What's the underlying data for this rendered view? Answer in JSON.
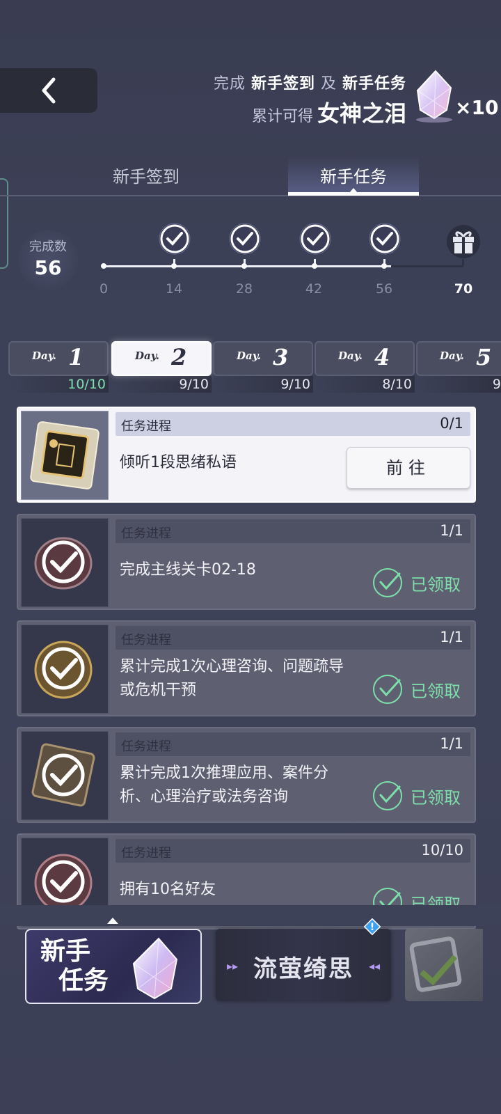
{
  "header": {
    "promo_prefix": "完成",
    "promo_item1": "新手签到",
    "promo_and": "及",
    "promo_item2": "新手任务",
    "promo_line2_prefix": "累计可得",
    "reward_name": "女神之泪",
    "reward_count": "×10"
  },
  "tabs": [
    {
      "label": "新手签到",
      "active": false
    },
    {
      "label": "新手任务",
      "active": true
    }
  ],
  "completion": {
    "label": "完成数",
    "value": "56",
    "milestones": [
      "0",
      "14",
      "28",
      "42",
      "56",
      "70"
    ],
    "reached": [
      true,
      true,
      true,
      true,
      true,
      false
    ]
  },
  "days": [
    {
      "label": "Day.",
      "num": "1",
      "progress": "10/10",
      "active": false
    },
    {
      "label": "Day.",
      "num": "2",
      "progress": "9/10",
      "active": true
    },
    {
      "label": "Day.",
      "num": "3",
      "progress": "9/10",
      "active": false
    },
    {
      "label": "Day.",
      "num": "4",
      "progress": "8/10",
      "active": false
    },
    {
      "label": "Day.",
      "num": "5",
      "progress": "9",
      "active": false
    }
  ],
  "tasks": [
    {
      "progress_label": "任务进程",
      "progress": "0/1",
      "text": "倾听1段思绪私语",
      "action": "前往",
      "status": "todo"
    },
    {
      "progress_label": "任务进程",
      "progress": "1/1",
      "text": "完成主线关卡02-18",
      "action": "已领取",
      "status": "claimed"
    },
    {
      "progress_label": "任务进程",
      "progress": "1/1",
      "text": "累计完成1次心理咨询、问题疏导或危机干预",
      "action": "已领取",
      "status": "claimed"
    },
    {
      "progress_label": "任务进程",
      "progress": "1/1",
      "text": "累计完成1次推理应用、案件分析、心理治疗或法务咨询",
      "action": "已领取",
      "status": "claimed"
    },
    {
      "progress_label": "任务进程",
      "progress": "10/10",
      "text": "拥有10名好友",
      "action": "已领取",
      "status": "claimed"
    }
  ],
  "bottom_tabs": [
    {
      "label": "新手任务",
      "line1": "新手",
      "line2": "任务",
      "active": true
    },
    {
      "label": "流萤绮思",
      "active": false,
      "badge": "!"
    }
  ],
  "colors": {
    "background": "#3d4157",
    "claimed_green": "#7ddfaa",
    "full_progress": "#7fe0b2",
    "accent_purple": "#b49af4"
  }
}
